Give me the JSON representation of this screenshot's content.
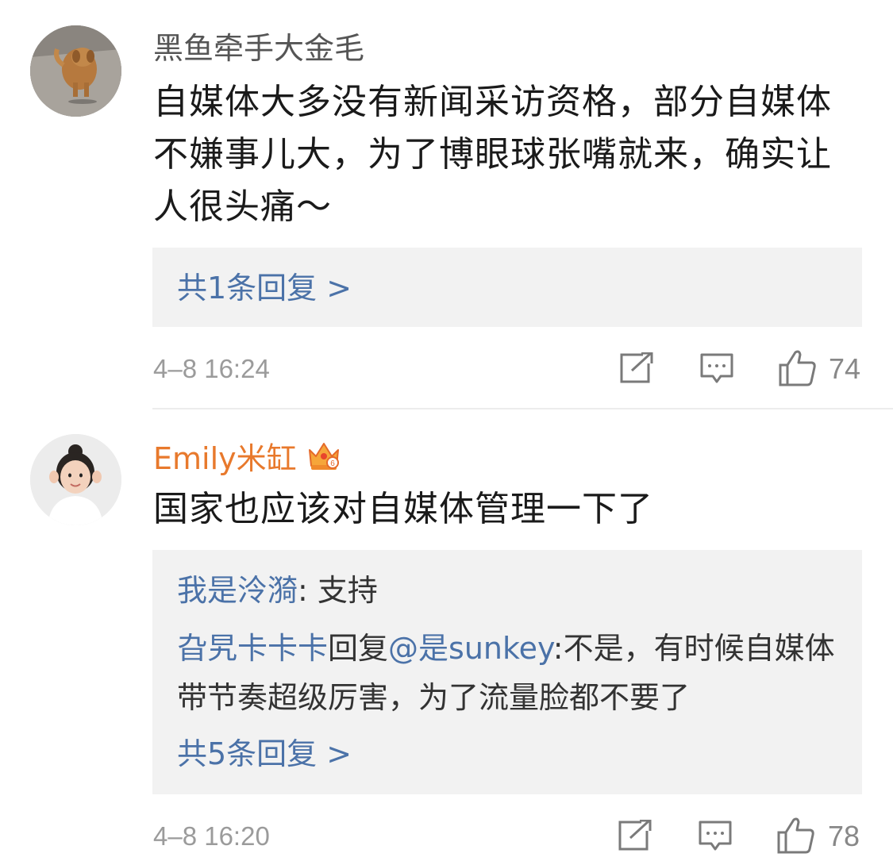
{
  "comments": [
    {
      "username": "黑鱼牵手大金毛",
      "content": "自媒体大多没有新闻采访资格，部分自媒体不嫌事儿大，为了博眼球张嘴就来，确实让人很头痛～",
      "reply_summary": "共1条回复 >",
      "time": "4–8 16:24",
      "likes": "74",
      "avatar_icon": "dog-avatar",
      "name_color": "#555555"
    },
    {
      "username": "Emily米缸",
      "badge_icon": "crown-badge-icon",
      "content": "国家也应该对自媒体管理一下了",
      "replies": [
        {
          "author": "我是泠漪",
          "separator": ": ",
          "text": "支持"
        },
        {
          "author": "旮旯卡卡卡",
          "mid": "回复",
          "mention": "@是sunkey",
          "separator": ":",
          "text": "不是，有时候自媒体带节奏超级厉害，为了流量脸都不要了"
        }
      ],
      "reply_summary": "共5条回复 >",
      "time": "4–8 16:20",
      "likes": "78",
      "avatar_icon": "girl-avatar",
      "name_color": "#e8792c"
    }
  ],
  "colors": {
    "link_blue": "#4b72a8",
    "reply_bg": "#f2f2f2",
    "meta_gray": "#9b9b9b"
  }
}
